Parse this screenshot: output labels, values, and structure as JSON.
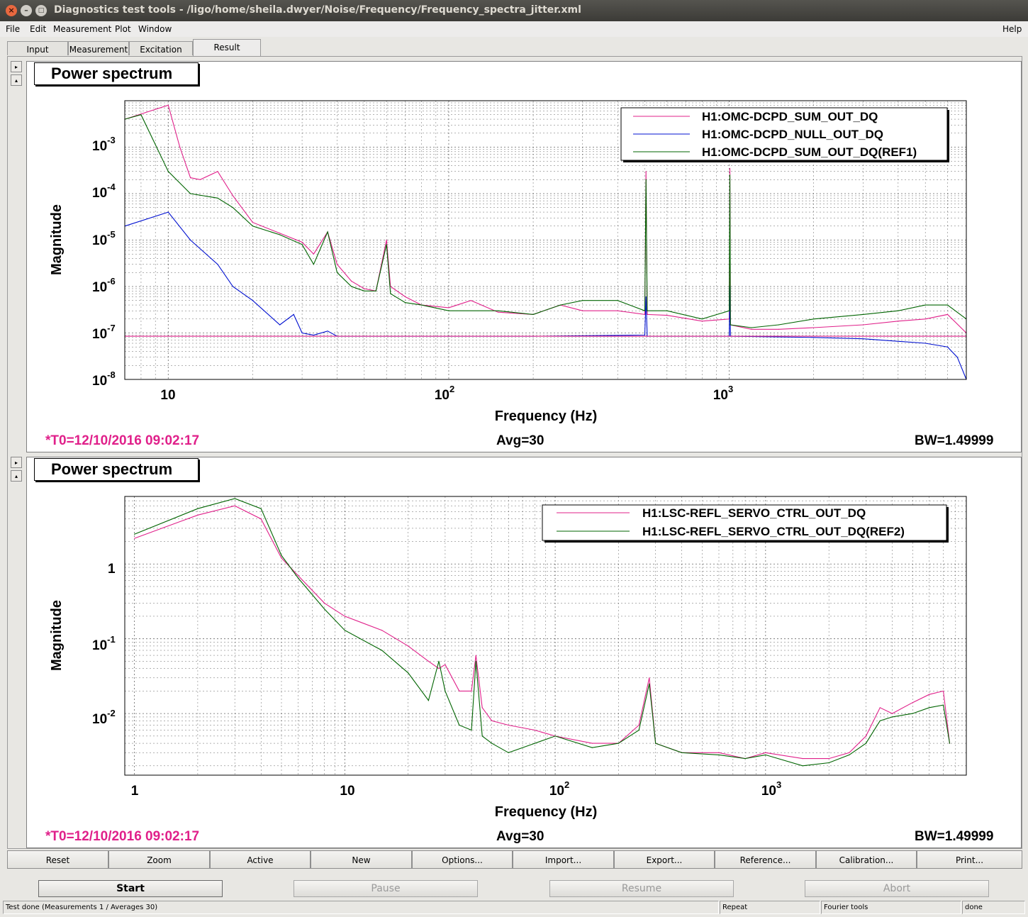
{
  "window": {
    "title": "Diagnostics test tools - /ligo/home/sheila.dwyer/Noise/Frequency/Frequency_spectra_jitter.xml",
    "close_glyph": "×",
    "minimize_glyph": "–",
    "maximize_glyph": "□"
  },
  "menu": {
    "file": "File",
    "edit": "Edit",
    "measurement": "Measurement",
    "plot": "Plot",
    "window": "Window",
    "help": "Help"
  },
  "tabs": [
    {
      "label": "Input"
    },
    {
      "label": "Measurement"
    },
    {
      "label": "Excitation"
    },
    {
      "label": "Result",
      "active": true
    }
  ],
  "side_buttons": {
    "expand": "▸",
    "collapse": "▴"
  },
  "colors": {
    "pink": "#e0208a",
    "blue": "#0010d0",
    "green": "#006400",
    "ref_horizontal": "#e0208a"
  },
  "panels": [
    {
      "title": "Power spectrum",
      "t0": "*T0=12/10/2016 09:02:17",
      "avg": "Avg=30",
      "bw": "BW=1.49999",
      "xlabel": "Frequency (Hz)",
      "ylabel": "Magnitude",
      "legend": [
        "H1:OMC-DCPD_SUM_OUT_DQ",
        "H1:OMC-DCPD_NULL_OUT_DQ",
        "H1:OMC-DCPD_SUM_OUT_DQ(REF1)"
      ],
      "x_ticks": [
        {
          "base": "10",
          "exp": ""
        },
        {
          "base": "10",
          "exp": "2"
        },
        {
          "base": "10",
          "exp": "3"
        }
      ],
      "y_ticks": [
        {
          "base": "10",
          "exp": "-3"
        },
        {
          "base": "10",
          "exp": "-4"
        },
        {
          "base": "10",
          "exp": "-5"
        },
        {
          "base": "10",
          "exp": "-6"
        },
        {
          "base": "10",
          "exp": "-7"
        },
        {
          "base": "10",
          "exp": "-8"
        }
      ]
    },
    {
      "title": "Power spectrum",
      "t0": "*T0=12/10/2016 09:02:17",
      "avg": "Avg=30",
      "bw": "BW=1.49999",
      "xlabel": "Frequency (Hz)",
      "ylabel": "Magnitude",
      "legend": [
        "H1:LSC-REFL_SERVO_CTRL_OUT_DQ",
        "H1:LSC-REFL_SERVO_CTRL_OUT_DQ(REF2)"
      ],
      "x_ticks": [
        {
          "base": "1",
          "exp": ""
        },
        {
          "base": "10",
          "exp": ""
        },
        {
          "base": "10",
          "exp": "2"
        },
        {
          "base": "10",
          "exp": "3"
        }
      ],
      "y_ticks": [
        {
          "base": "1",
          "exp": ""
        },
        {
          "base": "10",
          "exp": "-1"
        },
        {
          "base": "10",
          "exp": "-2"
        }
      ]
    }
  ],
  "chart_data": [
    {
      "type": "line",
      "title": "Power spectrum",
      "xlabel": "Frequency (Hz)",
      "ylabel": "Magnitude",
      "xscale": "log",
      "yscale": "log",
      "xlim": [
        7,
        7000
      ],
      "ylim": [
        1e-08,
        0.01
      ],
      "grid": true,
      "legend_position": "top-right",
      "series": [
        {
          "name": "H1:OMC-DCPD_SUM_OUT_DQ",
          "color": "#e0208a",
          "x": [
            7,
            10,
            11,
            12,
            13,
            15,
            17,
            20,
            25,
            30,
            33,
            37,
            40,
            45,
            50,
            55,
            60,
            62,
            70,
            80,
            100,
            120,
            150,
            200,
            250,
            300,
            400,
            500,
            505,
            510,
            600,
            800,
            1000,
            1005,
            1010,
            1200,
            1500,
            2000,
            3000,
            4000,
            5000,
            6000,
            7000
          ],
          "y": [
            0.004,
            0.008,
            0.001,
            0.00022,
            0.0002,
            0.0003,
            9e-05,
            2.4e-05,
            1.4e-05,
            9e-06,
            5e-06,
            1.5e-05,
            3e-06,
            1.3e-06,
            9e-07,
            8e-07,
            1e-05,
            1e-06,
            6e-07,
            4e-07,
            3.5e-07,
            5e-07,
            2.8e-07,
            2.5e-07,
            4e-07,
            3e-07,
            3e-07,
            2.5e-07,
            0.0003,
            2.5e-07,
            2.4e-07,
            1.8e-07,
            2e-07,
            0.00035,
            1.5e-07,
            1.2e-07,
            1.2e-07,
            1.3e-07,
            1.5e-07,
            1.8e-07,
            2e-07,
            2.5e-07,
            1e-07
          ]
        },
        {
          "name": "H1:OMC-DCPD_NULL_OUT_DQ",
          "color": "#0010d0",
          "x": [
            7,
            10,
            12,
            15,
            17,
            20,
            25,
            28,
            30,
            33,
            37,
            40,
            50,
            100,
            200,
            500,
            505,
            510,
            1000,
            1005,
            1010,
            2000,
            3000,
            5000,
            6000,
            6500,
            7000
          ],
          "y": [
            2e-05,
            4e-05,
            1e-05,
            3e-06,
            1e-06,
            5e-07,
            1.5e-07,
            2.5e-07,
            1e-07,
            9e-08,
            1.1e-07,
            8.5e-08,
            8.5e-08,
            8.5e-08,
            8.5e-08,
            9e-08,
            6e-07,
            8.5e-08,
            8.5e-08,
            1e-06,
            8.5e-08,
            8e-08,
            7.5e-08,
            6e-08,
            5e-08,
            3e-08,
            1e-08
          ]
        },
        {
          "name": "H1:OMC-DCPD_SUM_OUT_DQ(REF1)",
          "color": "#006400",
          "x": [
            7,
            8,
            10,
            12,
            15,
            17,
            20,
            25,
            30,
            33,
            37,
            40,
            45,
            50,
            55,
            60,
            62,
            70,
            80,
            100,
            150,
            200,
            250,
            300,
            400,
            500,
            505,
            510,
            600,
            800,
            1000,
            1005,
            1010,
            1200,
            1500,
            2000,
            3000,
            4000,
            5000,
            6000,
            7000
          ],
          "y": [
            0.004,
            0.005,
            0.0003,
            0.0001,
            8e-05,
            5e-05,
            2e-05,
            1.3e-05,
            8e-06,
            3e-06,
            1.5e-05,
            2e-06,
            1e-06,
            8e-07,
            8e-07,
            8e-06,
            7e-07,
            4.5e-07,
            4e-07,
            3e-07,
            3e-07,
            2.5e-07,
            4e-07,
            5e-07,
            5e-07,
            3e-07,
            0.0002,
            3e-07,
            3e-07,
            2e-07,
            3e-07,
            0.00025,
            1.5e-07,
            1.3e-07,
            1.5e-07,
            2e-07,
            2.5e-07,
            3e-07,
            4e-07,
            4e-07,
            2e-07
          ]
        },
        {
          "name": "",
          "color": "#e0208a",
          "x": [
            7,
            7000
          ],
          "y": [
            8.5e-08,
            8.5e-08
          ]
        }
      ]
    },
    {
      "type": "line",
      "title": "Power spectrum",
      "xlabel": "Frequency (Hz)",
      "ylabel": "Magnitude",
      "xscale": "log",
      "yscale": "log",
      "xlim": [
        0.9,
        9000
      ],
      "ylim": [
        0.0015,
        8
      ],
      "grid": true,
      "legend_position": "top-right",
      "series": [
        {
          "name": "H1:LSC-REFL_SERVO_CTRL_OUT_DQ",
          "color": "#e0208a",
          "x": [
            1,
            2,
            3,
            4,
            5,
            6,
            8,
            10,
            15,
            20,
            25,
            28,
            30,
            35,
            40,
            42,
            45,
            50,
            60,
            80,
            100,
            150,
            200,
            250,
            280,
            300,
            400,
            600,
            800,
            1000,
            1500,
            2000,
            2500,
            3000,
            3500,
            4000,
            5000,
            6000,
            7000,
            7500
          ],
          "y": [
            2.2,
            4.5,
            6,
            4,
            1.2,
            0.7,
            0.3,
            0.2,
            0.13,
            0.08,
            0.05,
            0.04,
            0.045,
            0.02,
            0.02,
            0.06,
            0.012,
            0.008,
            0.007,
            0.006,
            0.005,
            0.004,
            0.004,
            0.007,
            0.03,
            0.004,
            0.003,
            0.003,
            0.0025,
            0.003,
            0.0025,
            0.0025,
            0.003,
            0.005,
            0.012,
            0.01,
            0.014,
            0.018,
            0.02,
            0.004
          ]
        },
        {
          "name": "H1:LSC-REFL_SERVO_CTRL_OUT_DQ(REF2)",
          "color": "#006400",
          "x": [
            1,
            2,
            3,
            4,
            5,
            6,
            8,
            10,
            15,
            20,
            25,
            28,
            30,
            35,
            40,
            42,
            45,
            50,
            60,
            80,
            100,
            150,
            200,
            250,
            280,
            300,
            400,
            600,
            800,
            1000,
            1500,
            2000,
            2500,
            3000,
            3500,
            4000,
            5000,
            6000,
            7000,
            7500
          ],
          "y": [
            2.5,
            5.5,
            7.5,
            5.5,
            1.3,
            0.65,
            0.25,
            0.13,
            0.07,
            0.035,
            0.015,
            0.05,
            0.02,
            0.007,
            0.006,
            0.05,
            0.005,
            0.004,
            0.003,
            0.004,
            0.005,
            0.0035,
            0.004,
            0.006,
            0.025,
            0.004,
            0.003,
            0.0028,
            0.0025,
            0.0028,
            0.002,
            0.0022,
            0.0028,
            0.004,
            0.008,
            0.009,
            0.01,
            0.012,
            0.013,
            0.004
          ]
        }
      ]
    }
  ],
  "bottom_buttons": [
    "Reset",
    "Zoom",
    "Active",
    "New",
    "Options...",
    "Import...",
    "Export...",
    "Reference...",
    "Calibration...",
    "Print..."
  ],
  "control_buttons": {
    "start": "Start",
    "pause": "Pause",
    "resume": "Resume",
    "abort": "Abort"
  },
  "status": {
    "message": "Test done (Measurements 1 / Averages 30)",
    "mode": "Repeat",
    "tool": "Fourier tools",
    "state": "done"
  }
}
